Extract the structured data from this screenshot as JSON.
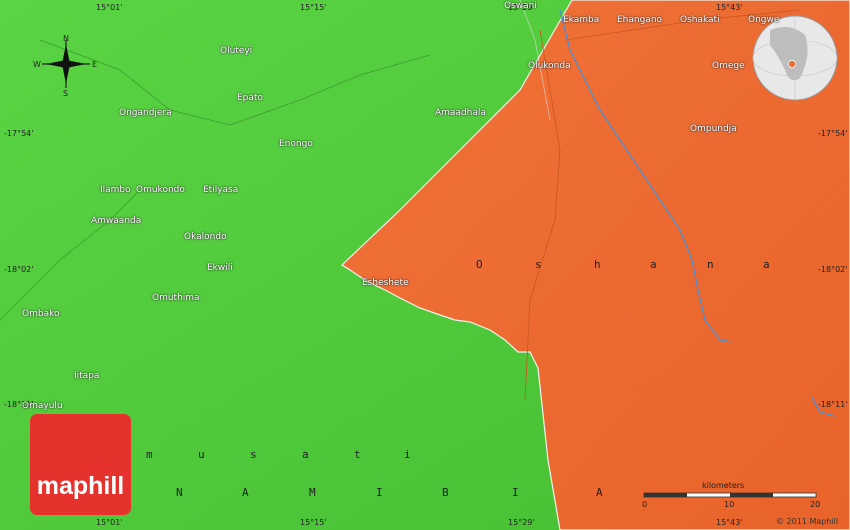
{
  "brand": {
    "logo_text": "maphill",
    "watermark": "maphill",
    "copyright": "© 2011 Maphill"
  },
  "compass": {
    "n": "N",
    "s": "S",
    "e": "E",
    "w": "W"
  },
  "coords": {
    "top": [
      "15°01'",
      "15°15'",
      "15°29'",
      "15°43'"
    ],
    "bottom": [
      "15°01'",
      "15°15'",
      "15°29'",
      "15°43'"
    ],
    "left": [
      "-17°54'",
      "-18°02'",
      "-18°11'"
    ],
    "right": [
      "-17°54'",
      "-18°02'",
      "-18°11'"
    ]
  },
  "regions": {
    "oshana_letters": [
      "O",
      "s",
      "h",
      "a",
      "n",
      "a"
    ],
    "omusati_letters": [
      "m",
      "u",
      "s",
      "a",
      "t",
      "i"
    ],
    "namibia_letters": [
      "N",
      "A",
      "M",
      "I",
      "B",
      "I",
      "A"
    ]
  },
  "places": [
    "Oswani",
    "Ekamba",
    "Ehangano",
    "Oshakati",
    "Ongwe",
    "Oluteyi",
    "Olukonda",
    "Omege",
    "Epato",
    "Ongandjera",
    "Amaadhala",
    "Ompundja",
    "Enongo",
    "Ilambo",
    "Omukondo",
    "Etilyasa",
    "Amwaanda",
    "Okalondo",
    "Ekwili",
    "Esheshete",
    "Omuthima",
    "Ombako",
    "Iitapa",
    "Omayulu"
  ],
  "scale": {
    "unit": "kilometers",
    "ticks": [
      "0",
      "10",
      "20"
    ]
  },
  "colors": {
    "omusati": "#4fca3a",
    "oshana": "#ec6a2e",
    "logo": "#e5322d",
    "river": "#4a8fd8"
  }
}
